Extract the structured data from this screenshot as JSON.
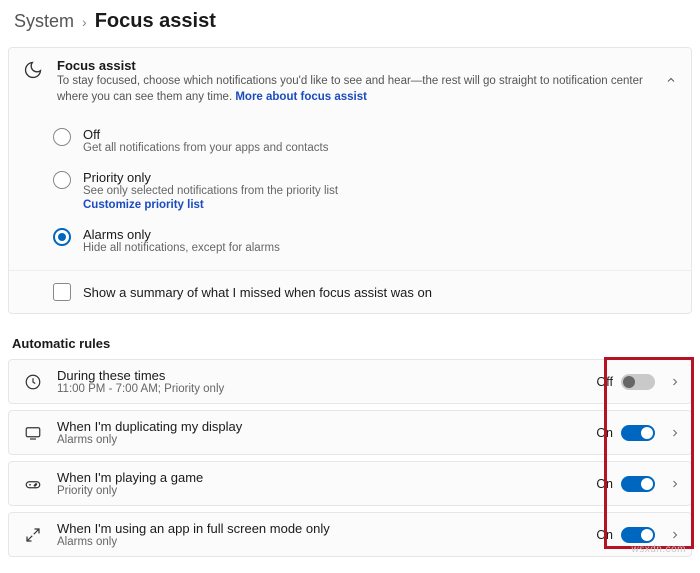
{
  "breadcrumb": {
    "parent": "System",
    "sep": "›",
    "title": "Focus assist"
  },
  "info": {
    "title": "Focus assist",
    "desc_prefix": "To stay focused, choose which notifications you'd like to see and hear—the rest will go straight to notification center where you can see them any time.  ",
    "link": "More about focus assist"
  },
  "modes": {
    "off": {
      "label": "Off",
      "sub": "Get all notifications from your apps and contacts"
    },
    "priority": {
      "label": "Priority only",
      "sub": "See only selected notifications from the priority list",
      "customize": "Customize priority list"
    },
    "alarms": {
      "label": "Alarms only",
      "sub": "Hide all notifications, except for alarms"
    }
  },
  "summary_checkbox": "Show a summary of what I missed when focus assist was on",
  "rules_heading": "Automatic rules",
  "rules": {
    "times": {
      "title": "During these times",
      "sub": "11:00 PM - 7:00 AM; Priority only",
      "state_label": "Off",
      "on": false
    },
    "display": {
      "title": "When I'm duplicating my display",
      "sub": "Alarms only",
      "state_label": "On",
      "on": true
    },
    "game": {
      "title": "When I'm playing a game",
      "sub": "Priority only",
      "state_label": "On",
      "on": true
    },
    "full": {
      "title": "When I'm using an app in full screen mode only",
      "sub": "Alarms only",
      "state_label": "On",
      "on": true
    }
  },
  "watermark": "wsxdn.com"
}
